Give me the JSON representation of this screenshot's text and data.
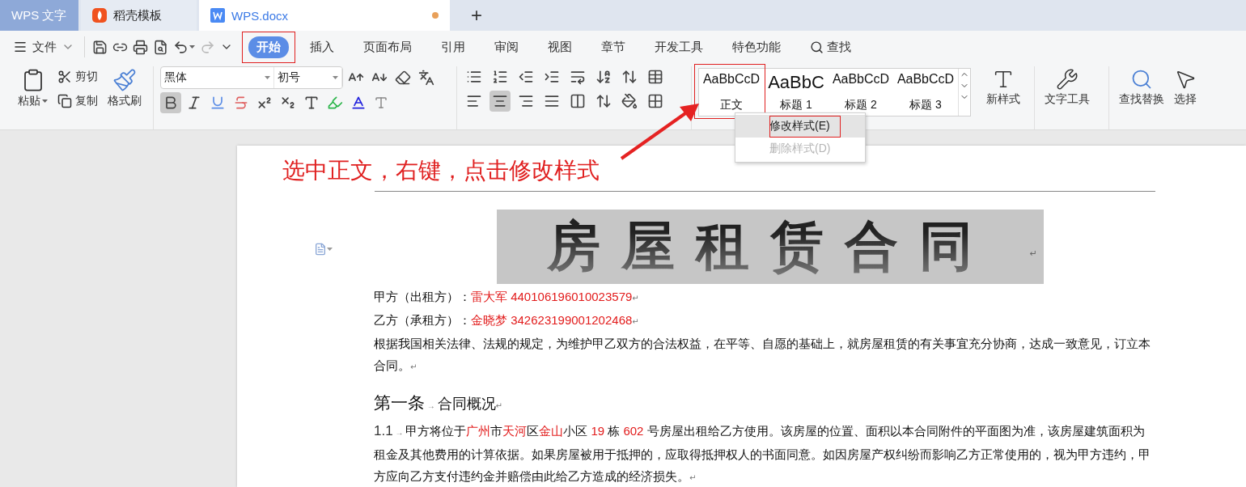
{
  "tabs": [
    {
      "label": "WPS 文字",
      "kind": "home",
      "selected": false,
      "unsaved": false
    },
    {
      "label": "稻壳模板",
      "kind": "template",
      "selected": false,
      "unsaved": false
    },
    {
      "label": "WPS.docx",
      "kind": "document",
      "selected": true,
      "unsaved": true
    }
  ],
  "new_tab": "+",
  "menu": {
    "file": "文件",
    "tabs": [
      {
        "label": "开始",
        "selected": true,
        "annotated": true,
        "kind": "tab"
      },
      {
        "label": "插入",
        "selected": false,
        "annotated": false,
        "kind": "tab"
      },
      {
        "label": "页面布局",
        "selected": false,
        "annotated": false,
        "kind": "tab"
      },
      {
        "label": "引用",
        "selected": false,
        "annotated": false,
        "kind": "tab"
      },
      {
        "label": "审阅",
        "selected": false,
        "annotated": false,
        "kind": "tab"
      },
      {
        "label": "视图",
        "selected": false,
        "annotated": false,
        "kind": "tab"
      },
      {
        "label": "章节",
        "selected": false,
        "annotated": false,
        "kind": "tab"
      },
      {
        "label": "开发工具",
        "selected": false,
        "annotated": false,
        "kind": "tab"
      },
      {
        "label": "特色功能",
        "selected": false,
        "annotated": false,
        "kind": "tab"
      },
      {
        "label": "查找",
        "selected": false,
        "annotated": false,
        "kind": "search"
      }
    ]
  },
  "ribbon": {
    "clipboard": {
      "paste": "粘贴",
      "cut": "剪切",
      "copy": "复制",
      "format_painter": "格式刷"
    },
    "font": {
      "name": "黑体",
      "size": "初号",
      "bold": true
    },
    "paragraph": {
      "align_buttons": [
        {
          "kind": "left",
          "selected": false
        },
        {
          "kind": "center",
          "selected": true
        },
        {
          "kind": "right",
          "selected": false
        },
        {
          "kind": "justify",
          "selected": false
        },
        {
          "kind": "distributed",
          "selected": false
        }
      ]
    },
    "styles": [
      {
        "preview": "AaBbCcD",
        "label": "正文",
        "kind": "body",
        "annotated": true
      },
      {
        "preview": "AaBbC",
        "label": "标题 1",
        "kind": "h1",
        "annotated": false
      },
      {
        "preview": "AaBbCcD",
        "label": "标题 2",
        "kind": "h2",
        "annotated": false
      },
      {
        "preview": "AaBbCcD",
        "label": "标题 3",
        "kind": "h3",
        "annotated": false
      }
    ],
    "new_style": "新样式",
    "text_tools": "文字工具",
    "find_replace": "查找替换",
    "select": "选择"
  },
  "context_menu": {
    "items": [
      {
        "label": "修改样式(E)",
        "highlighted": true,
        "disabled": false,
        "annotated": true
      },
      {
        "label": "删除样式(D)",
        "highlighted": false,
        "disabled": true,
        "annotated": false
      }
    ]
  },
  "annotation": {
    "text": "选中正文，右键，点击修改样式"
  },
  "document": {
    "title": "房屋租赁合同",
    "title_mark": "↵",
    "paragraphs": [
      {
        "kind": "body",
        "segments": [
          {
            "text": "甲方（出租方）：",
            "kind": "plain"
          },
          {
            "text": "雷大军 440106196010023579",
            "kind": "red"
          },
          {
            "text": "↵",
            "kind": "mark"
          }
        ]
      },
      {
        "kind": "body",
        "segments": [
          {
            "text": "乙方（承租方）：",
            "kind": "plain"
          },
          {
            "text": "金晓梦 342623199001202468",
            "kind": "red"
          },
          {
            "text": "↵",
            "kind": "mark"
          }
        ]
      },
      {
        "kind": "body",
        "segments": [
          {
            "text": "根据我国相关法律、法规的规定，为维护甲乙双方的合法权益，在平等、自愿的基础上，就房屋租赁的有关事宜充分协商，达成一致意见，订立本合同。",
            "kind": "plain"
          },
          {
            "text": "↵",
            "kind": "mark"
          }
        ]
      },
      {
        "kind": "heading",
        "segments": [
          {
            "text": "第一条",
            "kind": "plain"
          },
          {
            "text": " → ",
            "kind": "mark"
          },
          {
            "text": "合同概况",
            "kind": "small"
          },
          {
            "text": "↵",
            "kind": "mark"
          }
        ]
      },
      {
        "kind": "body",
        "segments": [
          {
            "text": "1.1",
            "kind": "number"
          },
          {
            "text": " → ",
            "kind": "mark"
          },
          {
            "text": "甲方将位于",
            "kind": "plain"
          },
          {
            "text": "广州",
            "kind": "red"
          },
          {
            "text": "市",
            "kind": "plain"
          },
          {
            "text": "天河",
            "kind": "red"
          },
          {
            "text": "区",
            "kind": "plain"
          },
          {
            "text": "金山",
            "kind": "red"
          },
          {
            "text": "小区 ",
            "kind": "plain"
          },
          {
            "text": "19",
            "kind": "red"
          },
          {
            "text": " 栋 ",
            "kind": "plain"
          },
          {
            "text": "602",
            "kind": "red"
          },
          {
            "text": " 号房屋出租给乙方使用。该房屋的位置、面积以本合同附件的平面图为准，该房屋建筑面积为租金及其他费用的计算依据。如果房屋被用于抵押的，应取得抵押权人的书面同意。如因房屋产权纠纷而影响乙方正常使用的，视为甲方违约，甲方应向乙方支付违约金并赔偿由此给乙方造成的经济损失。",
            "kind": "plain"
          },
          {
            "text": "↵",
            "kind": "mark"
          }
        ]
      }
    ]
  }
}
